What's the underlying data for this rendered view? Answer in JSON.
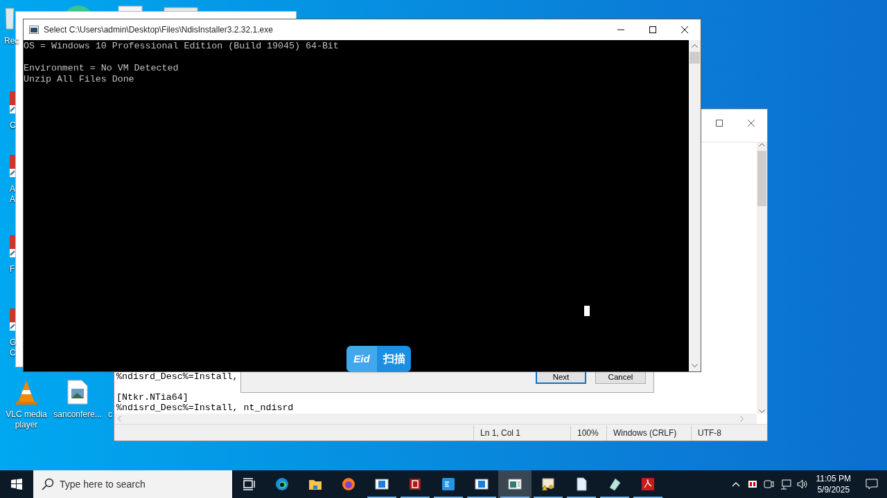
{
  "desktop_icons": [
    {
      "kind": "recycle",
      "lines": [
        "Rec"
      ]
    },
    {
      "kind": "shortcut",
      "lines": [
        "C"
      ]
    },
    {
      "kind": "shortcut",
      "lines": [
        "A",
        "A"
      ]
    },
    {
      "kind": "shortcut",
      "lines": [
        "F"
      ]
    },
    {
      "kind": "shortcut",
      "lines": [
        "G",
        "C"
      ]
    },
    {
      "kind": "vlc",
      "lines": [
        "VLC media",
        "player"
      ]
    },
    {
      "kind": "image",
      "lines": [
        "sanconfere..."
      ]
    },
    {
      "kind": "label_only",
      "lines": [
        "c"
      ]
    }
  ],
  "notepad": {
    "lines": [
      {
        "text": "%ndisrd_Desc%=Install,",
        "spaced": false
      },
      {
        "text": "[Ntkr.NTia64]",
        "spaced": true
      },
      {
        "text": "%ndisrd_Desc%=Install, nt_ndisrd",
        "spaced": false
      }
    ],
    "status_bar": [
      "Ln 1, Col 1",
      "100%",
      "Windows (CRLF)",
      "UTF-8"
    ]
  },
  "dialog": {
    "buttons": [
      {
        "label": "Next",
        "default": true
      },
      {
        "label": "Cancel",
        "default": false
      }
    ]
  },
  "console": {
    "title": "Select C:\\Users\\admin\\Desktop\\Files\\NdisInstaller3.2.32.1.exe",
    "lines": [
      {
        "text": "OS = Windows 10 Professional Edition (Build 19045) 64-Bit",
        "spaced": false
      },
      {
        "text": "Environment = No VM Detected",
        "spaced": true
      },
      {
        "text": "Unzip All Files Done",
        "spaced": false
      }
    ]
  },
  "scan_widget": {
    "logo": "Eid",
    "label": "扫描"
  },
  "taskbar": {
    "search": {
      "placeholder": "Type here to search"
    },
    "apps": [
      {
        "kind": "taskview",
        "running": false,
        "selected": false
      },
      {
        "kind": "edge",
        "running": false,
        "selected": false
      },
      {
        "kind": "folder",
        "running": false,
        "selected": false
      },
      {
        "kind": "firefox",
        "running": false,
        "selected": false
      },
      {
        "kind": "window",
        "running": true,
        "selected": false
      },
      {
        "kind": "redapp",
        "running": true,
        "selected": false
      },
      {
        "kind": "eid",
        "running": true,
        "selected": false
      },
      {
        "kind": "window",
        "running": true,
        "selected": false
      },
      {
        "kind": "console",
        "running": true,
        "selected": true
      },
      {
        "kind": "certificate",
        "running": true,
        "selected": false
      },
      {
        "kind": "document",
        "running": true,
        "selected": false
      },
      {
        "kind": "notepad",
        "running": true,
        "selected": false
      },
      {
        "kind": "pdf",
        "running": true,
        "selected": false
      }
    ],
    "time": "11:05 PM",
    "date": "5/9/2025"
  }
}
